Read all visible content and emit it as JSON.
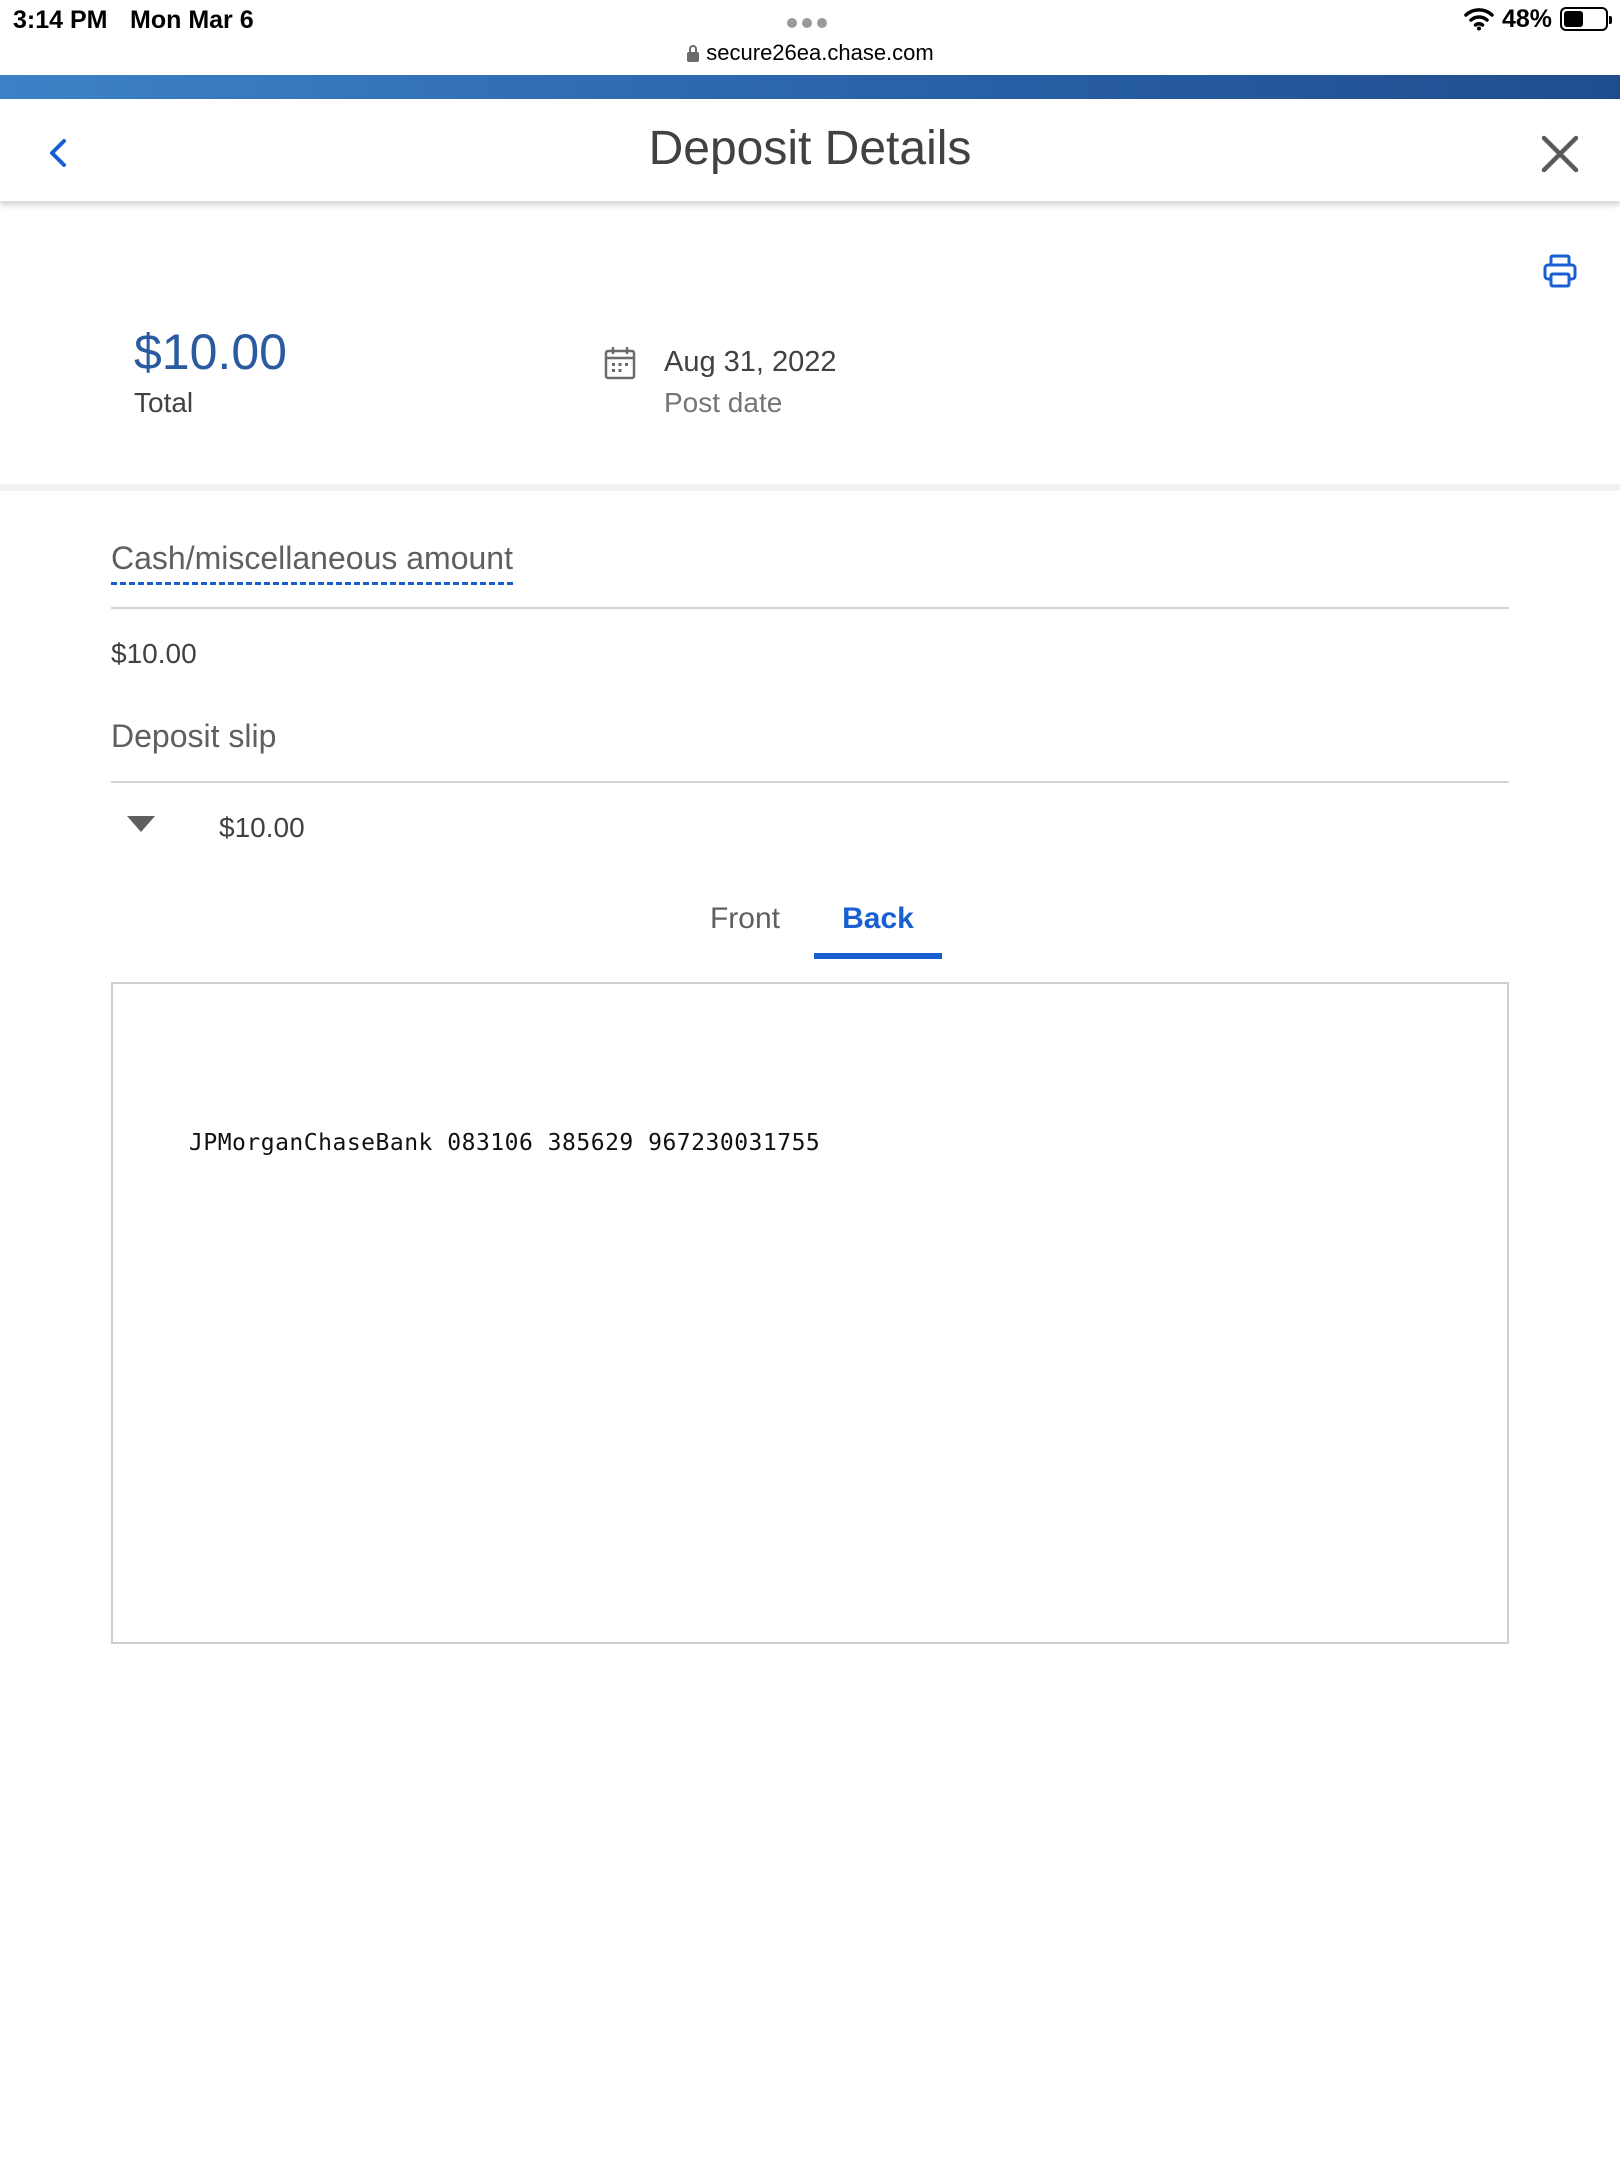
{
  "status_bar": {
    "time": "3:14 PM",
    "date": "Mon Mar 6",
    "url": "secure26ea.chase.com",
    "battery_percent": "48%",
    "battery_level": 0.48
  },
  "header": {
    "title": "Deposit Details",
    "back_icon": "chevron-left-icon",
    "close_icon": "close-icon"
  },
  "summary": {
    "print_icon": "printer-icon",
    "total_amount": "$10.00",
    "total_label": "Total",
    "post_date": "Aug 31, 2022",
    "post_date_label": "Post date"
  },
  "cash_section": {
    "title": "Cash/miscellaneous amount",
    "amount": "$10.00"
  },
  "deposit_slip": {
    "title": "Deposit slip",
    "amount": "$10.00",
    "tabs": [
      {
        "label": "Front",
        "active": false
      },
      {
        "label": "Back",
        "active": true
      }
    ],
    "image_text": "JPMorganChaseBank 083106 385629 967230031755"
  },
  "colors": {
    "accent_blue": "#1a5fd1",
    "amount_blue": "#2a5aa0",
    "text_dark": "#414042",
    "text_muted": "#757575"
  }
}
